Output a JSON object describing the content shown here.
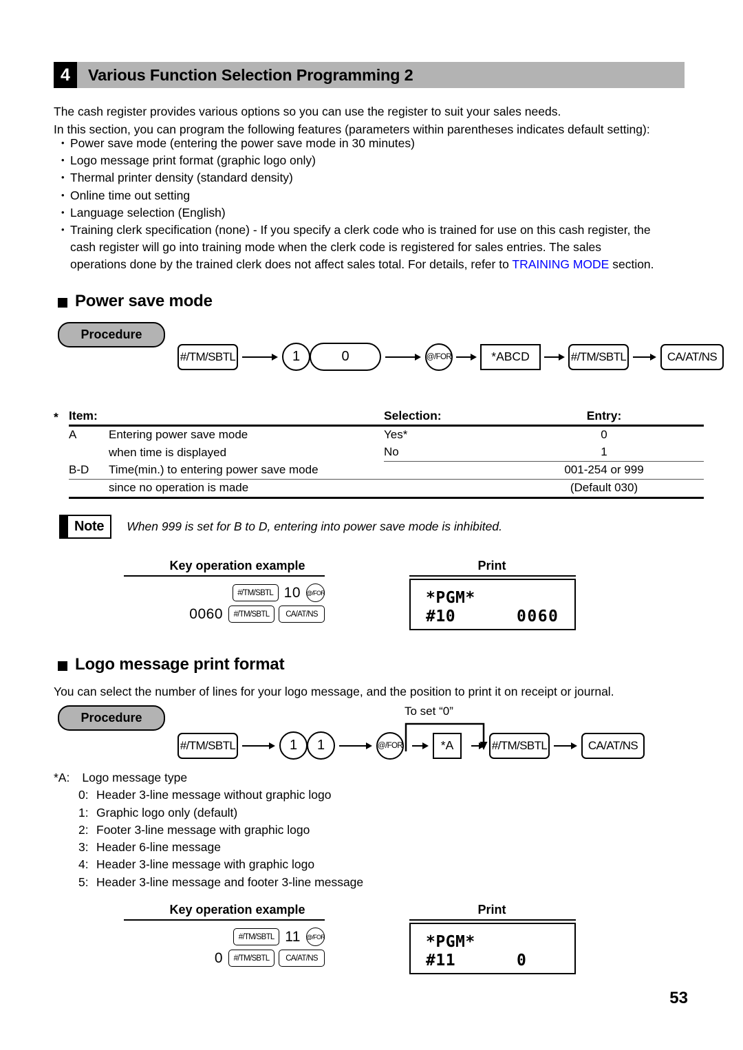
{
  "header": {
    "number": "4",
    "title": "Various Function Selection Programming 2"
  },
  "intro": {
    "line1": "The cash register provides various options so you can use the register to suit your sales needs.",
    "line2": "In this section, you can program the following features (parameters within parentheses indicates default setting):"
  },
  "features": [
    "Power save mode (entering the power save mode in 30 minutes)",
    "Logo message print format (graphic logo only)",
    "Thermal printer density (standard density)",
    "Online time out setting",
    "Language selection (English)"
  ],
  "training_bullet": {
    "part1": "Training clerk specification (none) - If you specify a clerk code who is trained for use on this cash register, the",
    "part2": "cash register will go into training mode when the clerk code is registered for sales entries.  The sales",
    "part3_a": "operations done by the trained clerk does not affect sales total.  For details, refer to ",
    "part3_link": "TRAINING MODE",
    "part3_b": " section."
  },
  "power_save": {
    "heading": "Power save mode",
    "procedure_label": "Procedure",
    "keys": {
      "k1": "#/TM/SBTL",
      "k2": "1",
      "k3": "0",
      "k4": "@/FOR",
      "k5": "*ABCD",
      "k6": "#/TM/SBTL",
      "k7": "CA/AT/NS"
    },
    "table": {
      "star": "*",
      "headers": {
        "item": "Item:",
        "selection": "Selection:",
        "entry": "Entry:"
      },
      "rows": [
        {
          "code": "A",
          "item_line1": "Entering power save mode",
          "item_line2": "when time is displayed",
          "sel_line1": "Yes*",
          "sel_line2": "No",
          "entry_line1": "0",
          "entry_line2": "1"
        },
        {
          "code": "B-D",
          "item_line1": "Time(min.) to entering power save mode",
          "item_line2": "since no operation is made",
          "sel_line1": "",
          "sel_line2": "",
          "entry_line1": "001-254 or 999",
          "entry_line2": "(Default 030)"
        }
      ]
    },
    "note": {
      "label": "Note",
      "text": "When 999 is set for B to D, entering into power save mode is inhibited."
    },
    "example": {
      "key_op_title": "Key operation example",
      "print_title": "Print",
      "row1": {
        "key1": "#/TM/SBTL",
        "num": "10",
        "key2": "@/FOR"
      },
      "row2": {
        "num": "0060",
        "key1": "#/TM/SBTL",
        "key2": "CA/AT/NS"
      },
      "receipt": {
        "line1": "*PGM*",
        "line2_label": "#10",
        "line2_value": "0060"
      }
    }
  },
  "logo_format": {
    "heading": "Logo message print format",
    "intro": "You can select the number of lines for your logo message, and the position to print it on receipt or journal.",
    "procedure_label": "Procedure",
    "bypass_label": "To set “0”",
    "keys": {
      "k1": "#/TM/SBTL",
      "k2": "1",
      "k3": "1",
      "k4": "@/FOR",
      "k5": "*A",
      "k6": "#/TM/SBTL",
      "k7": "CA/AT/NS"
    },
    "a_list": {
      "label": "*A:",
      "title": "Logo message type",
      "options": [
        {
          "n": "0:",
          "text": "Header 3-line message without graphic logo"
        },
        {
          "n": "1:",
          "text": "Graphic logo only (default)"
        },
        {
          "n": "2:",
          "text": "Footer 3-line message with graphic logo"
        },
        {
          "n": "3:",
          "text": "Header 6-line message"
        },
        {
          "n": "4:",
          "text": "Header 3-line message with graphic logo"
        },
        {
          "n": "5:",
          "text": "Header 3-line message and footer 3-line message"
        }
      ]
    },
    "example": {
      "key_op_title": "Key operation example",
      "print_title": "Print",
      "row1": {
        "key1": "#/TM/SBTL",
        "num": "11",
        "key2": "@/FOR"
      },
      "row2": {
        "num": "0",
        "key1": "#/TM/SBTL",
        "key2": "CA/AT/NS"
      },
      "receipt": {
        "line1": "*PGM*",
        "line2_label": "#11",
        "line2_value": "0"
      }
    }
  },
  "footer": {
    "page_number": "53"
  },
  "colors": {
    "header_bar": "#b3b3b3",
    "link": "#0000ff",
    "badge": "#b3b3b3"
  }
}
